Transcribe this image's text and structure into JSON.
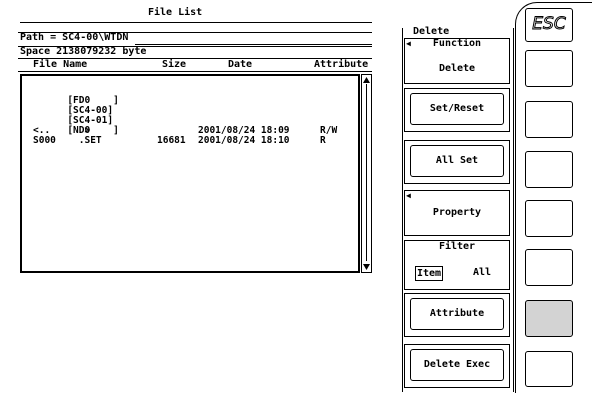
{
  "file_list": {
    "title": "File List",
    "path": "Path = SC4-00\\WTDN",
    "space": "Space 2138079232 byte",
    "columns": [
      "File Name",
      "Size",
      "Date",
      "Attribute"
    ],
    "rows": [
      {
        "name": "[FD0    ]",
        "size": "",
        "date": "",
        "attr": ""
      },
      {
        "name": "[SC4-00]",
        "size": "",
        "date": "",
        "attr": ""
      },
      {
        "name": "[SC4-01]",
        "size": "",
        "date": "",
        "attr": ""
      },
      {
        "name": "[ND0    ]",
        "size": "",
        "date": "",
        "attr": ""
      },
      {
        "name": "<..      >",
        "size": "",
        "date": "2001/08/24 18:09",
        "attr": "R/W"
      },
      {
        "name": "S000    .SET",
        "size": "16681",
        "date": "2001/08/24 18:10",
        "attr": "R"
      }
    ]
  },
  "menu": {
    "title": "Delete",
    "function_label": "Function",
    "function_value": "Delete",
    "set_reset": "Set/Reset",
    "all_set": "All Set",
    "property": "Property",
    "filter_label": "Filter",
    "filter_item": "Item",
    "filter_all": "All",
    "attribute": "Attribute",
    "delete_exec": "Delete Exec"
  },
  "softkeys": {
    "esc": "ESC"
  }
}
